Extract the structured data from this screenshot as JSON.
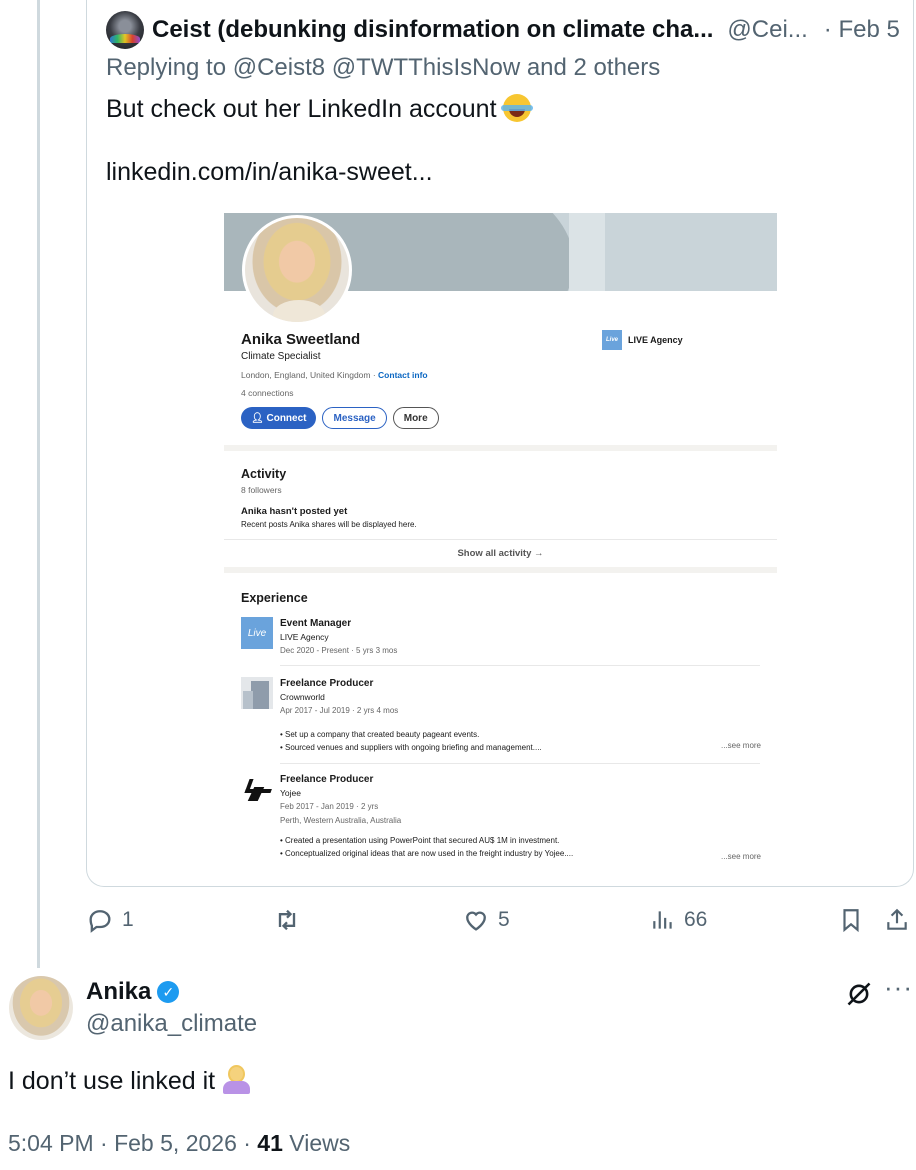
{
  "quoted_tweet": {
    "author_name": "Ceist (debunking disinformation on climate cha...",
    "author_handle": "@Cei...",
    "date": "· Feb 5",
    "replying_to": "Replying to @Ceist8 @TWTThisIsNow and 2 others",
    "text": "But check out her LinkedIn account",
    "link": "linkedin.com/in/anika-sweet..."
  },
  "linkedin": {
    "name": "Anika Sweetland",
    "headline": "Climate Specialist",
    "location": "London, England, United Kingdom · ",
    "contact_info": "Contact info",
    "connections": "4 connections",
    "buttons": {
      "connect": "Connect",
      "message": "Message",
      "more": "More"
    },
    "company": "LIVE Agency",
    "company_logo": "Live",
    "activity": {
      "title": "Activity",
      "followers": "8 followers",
      "no_posts": "Anika hasn't posted yet",
      "no_posts_sub": "Recent posts Anika shares will be displayed here.",
      "show_all": "Show all activity →"
    },
    "experience": {
      "title": "Experience",
      "jobs": [
        {
          "title": "Event Manager",
          "company": "LIVE Agency",
          "dates": "Dec 2020 - Present · 5 yrs 3 mos",
          "logo": "Live"
        },
        {
          "title": "Freelance Producer",
          "company": "Crownworld",
          "dates": "Apr 2017 - Jul 2019 · 2 yrs 4 mos",
          "bullets": [
            "• Set up a company that created beauty pageant events.",
            "• Sourced venues and suppliers with ongoing briefing and management...."
          ],
          "see_more": "...see more"
        },
        {
          "title": "Freelance Producer",
          "company": "Yojee",
          "dates": "Feb 2017 - Jan 2019 · 2 yrs",
          "location": "Perth, Western Australia, Australia",
          "bullets": [
            "• Created a presentation using PowerPoint that secured AU$ 1M in investment.",
            "• Conceptualized original ideas that are now used in the freight industry by Yojee...."
          ],
          "see_more": "...see more"
        }
      ]
    }
  },
  "actions": {
    "replies": "1",
    "likes": "5",
    "views": "66"
  },
  "reply": {
    "author_name": "Anika",
    "author_handle": "@anika_climate",
    "text": "I don’t use linked it",
    "time_date": "5:04 PM · Feb 5, 2026 · ",
    "views_count": "41",
    "views_label": " Views"
  },
  "colors": {
    "accent": "#1d9bf0",
    "secondary_text": "#536471",
    "linkedin_blue": "#0a66c2"
  },
  "icons": [
    "reply-icon",
    "retweet-icon",
    "like-icon",
    "views-icon",
    "bookmark-icon",
    "share-icon",
    "grok-icon",
    "more-icon",
    "verified-badge-icon"
  ]
}
